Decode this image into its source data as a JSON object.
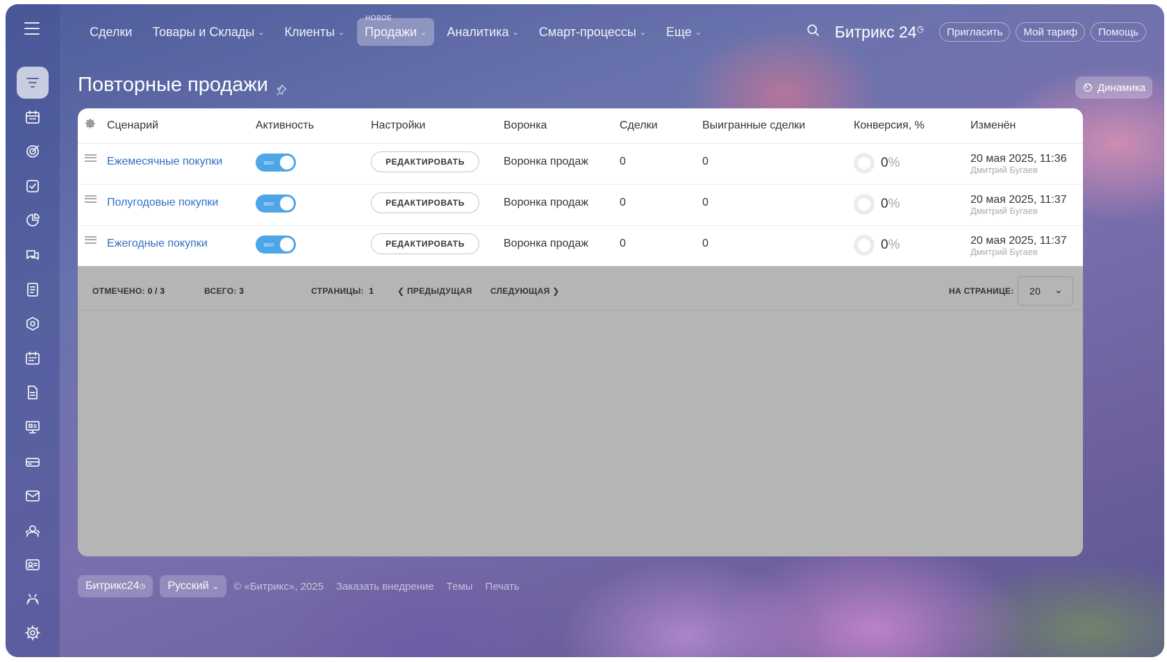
{
  "topnav": {
    "items": [
      {
        "label": "Сделки",
        "chevron": false
      },
      {
        "label": "Товары и Склады",
        "chevron": true
      },
      {
        "label": "Клиенты",
        "chevron": true
      },
      {
        "label": "Продажи",
        "chevron": true,
        "badge": "НОВОЕ",
        "active": true
      },
      {
        "label": "Аналитика",
        "chevron": true
      },
      {
        "label": "Смарт-процессы",
        "chevron": true
      },
      {
        "label": "Еще",
        "chevron": true
      }
    ],
    "brand": "Битрикс 24",
    "invite": "Пригласить",
    "tariff": "Мой тариф",
    "help": "Помощь"
  },
  "sidebar": {
    "icons": [
      "funnel-icon",
      "calendar-grid-icon",
      "target-icon",
      "checkbox-icon",
      "chart-icon",
      "chat-icon",
      "document-icon",
      "hexagon-icon",
      "calendar-icon",
      "file-icon",
      "presentation-icon",
      "card-icon",
      "mail-icon",
      "users-icon",
      "contact-card-icon",
      "robot-icon"
    ],
    "settings_icon": "gear-icon"
  },
  "page": {
    "title": "Повторные продажи",
    "dynamics_button": "Динамика"
  },
  "table": {
    "headers": [
      "Сценарий",
      "Активность",
      "Настройки",
      "Воронка",
      "Сделки",
      "Выигранные сделки",
      "Конверсия, %",
      "Изменён"
    ],
    "rows": [
      {
        "name": "Ежемесячные покупки",
        "toggle": "вкл",
        "edit": "РЕДАКТИРОВАТЬ",
        "funnel": "Воронка продаж",
        "deals": "0",
        "won": "0",
        "conversion": "0",
        "date": "20 мая 2025, 11:36",
        "user": "Дмитрий Бугаев"
      },
      {
        "name": "Полугодовые покупки",
        "toggle": "вкл",
        "edit": "РЕДАКТИРОВАТЬ",
        "funnel": "Воронка продаж",
        "deals": "0",
        "won": "0",
        "conversion": "0",
        "date": "20 мая 2025, 11:37",
        "user": "Дмитрий Бугаев"
      },
      {
        "name": "Ежегодные покупки",
        "toggle": "вкл",
        "edit": "РЕДАКТИРОВАТЬ",
        "funnel": "Воронка продаж",
        "deals": "0",
        "won": "0",
        "conversion": "0",
        "date": "20 мая 2025, 11:37",
        "user": "Дмитрий Бугаев"
      }
    ],
    "percent_sign": "%"
  },
  "pager": {
    "selected_label": "ОТМЕЧЕНО:",
    "selected_value": "0 / 3",
    "total_label": "ВСЕГО:",
    "total_value": "3",
    "pages_label": "СТРАНИЦЫ:",
    "pages_value": "1",
    "prev": "ПРЕДЫДУЩАЯ",
    "next": "СЛЕДУЮЩАЯ",
    "per_page_label": "НА СТРАНИЦЕ:",
    "per_page_value": "20"
  },
  "footer": {
    "brand": "Битрикс24",
    "language": "Русский",
    "copyright": "© «Битрикс», 2025",
    "order": "Заказать внедрение",
    "themes": "Темы",
    "print": "Печать"
  }
}
